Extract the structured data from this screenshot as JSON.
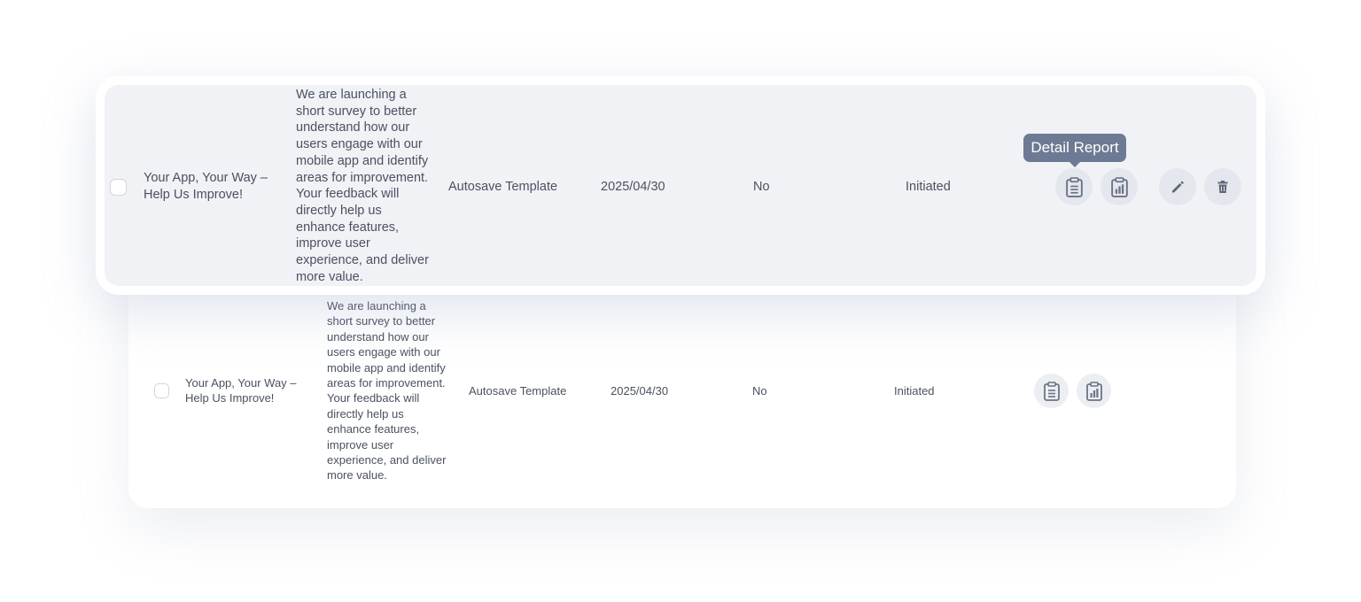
{
  "tooltip": {
    "text": "Detail Report"
  },
  "rows": [
    {
      "name": "Your App, Your Way – Help Us Improve!",
      "description": "We are launching a short survey to better understand how our users engage with our mobile app and identify areas for improvement. Your feedback will directly help us enhance features, improve user experience, and deliver more value.",
      "template": "Autosave Template",
      "date": "2025/04/30",
      "flag": "No",
      "status": "Initiated",
      "actions": [
        "clipboard-icon",
        "clipboard-chart-icon",
        "pencil-icon",
        "trash-icon"
      ]
    },
    {
      "name": "Your App, Your Way – Help Us Improve!",
      "description": "We are launching a short survey to better understand how our users engage with our mobile app and identify areas for improvement. Your feedback will directly help us enhance features, improve user experience, and deliver more value.",
      "template": "Autosave Template",
      "date": "2025/04/30",
      "flag": "No",
      "status": "Initiated",
      "actions": [
        "clipboard-icon",
        "clipboard-chart-icon"
      ]
    }
  ],
  "colors": {
    "text": "#4a5160",
    "row_highlight": "#f0f2f6",
    "icon_button": "#e4e7ed",
    "icon": "#6b7485",
    "tooltip_bg": "#6e7a93"
  }
}
